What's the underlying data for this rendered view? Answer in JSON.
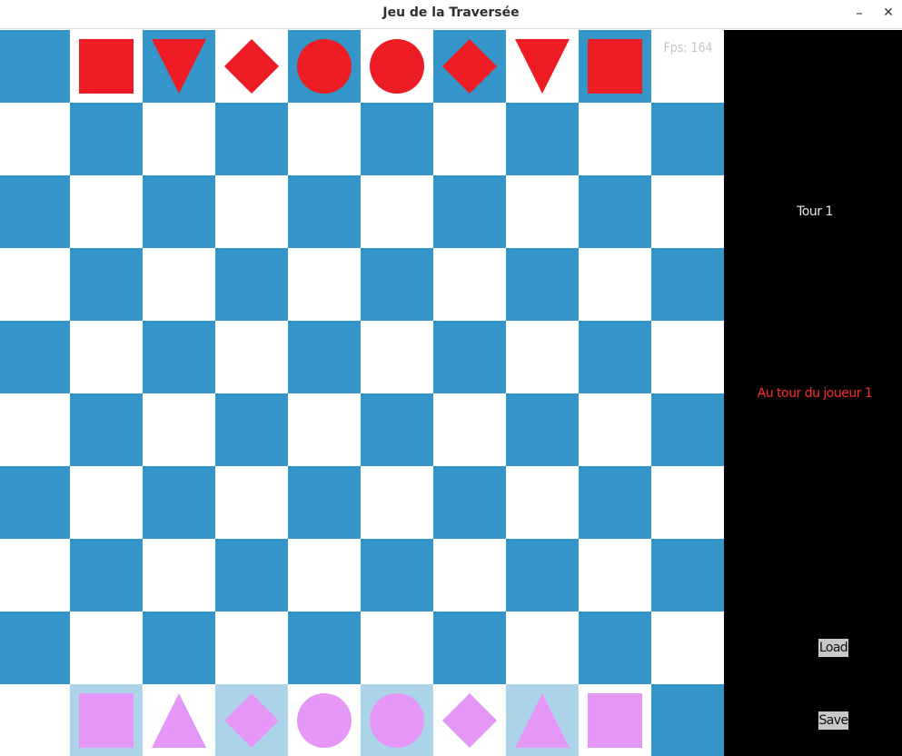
{
  "window": {
    "title": "Jeu de la Traversée",
    "minimize_symbol": "–",
    "close_symbol": "✕"
  },
  "hud": {
    "fps": "Fps: 164",
    "turn": "Tour 1",
    "current_player": "Au tour du joueur 1",
    "load_label": "Load",
    "save_label": "Save"
  },
  "colors": {
    "dark_square": "#3496c8",
    "light_square": "#ffffff",
    "highlight_square": "#acd4e8",
    "red_piece": "#ee1c25",
    "pink_piece": "#e597f7",
    "sidebar": "#000000"
  },
  "board": {
    "columns": 10,
    "rows": 10,
    "highlighted_cells": [
      {
        "col": 1,
        "row": 9
      },
      {
        "col": 3,
        "row": 9
      },
      {
        "col": 5,
        "row": 9
      },
      {
        "col": 7,
        "row": 9
      }
    ],
    "pieces": [
      {
        "player": 2,
        "shape": "square",
        "col": 1,
        "row": 0
      },
      {
        "player": 2,
        "shape": "triangle-down",
        "col": 2,
        "row": 0
      },
      {
        "player": 2,
        "shape": "diamond",
        "col": 3,
        "row": 0
      },
      {
        "player": 2,
        "shape": "circle",
        "col": 4,
        "row": 0
      },
      {
        "player": 2,
        "shape": "circle",
        "col": 5,
        "row": 0
      },
      {
        "player": 2,
        "shape": "diamond",
        "col": 6,
        "row": 0
      },
      {
        "player": 2,
        "shape": "triangle-down",
        "col": 7,
        "row": 0
      },
      {
        "player": 2,
        "shape": "square",
        "col": 8,
        "row": 0
      },
      {
        "player": 1,
        "shape": "square",
        "col": 1,
        "row": 9
      },
      {
        "player": 1,
        "shape": "triangle-up",
        "col": 2,
        "row": 9
      },
      {
        "player": 1,
        "shape": "diamond",
        "col": 3,
        "row": 9
      },
      {
        "player": 1,
        "shape": "circle",
        "col": 4,
        "row": 9
      },
      {
        "player": 1,
        "shape": "circle",
        "col": 5,
        "row": 9
      },
      {
        "player": 1,
        "shape": "diamond",
        "col": 6,
        "row": 9
      },
      {
        "player": 1,
        "shape": "triangle-up",
        "col": 7,
        "row": 9
      },
      {
        "player": 1,
        "shape": "square",
        "col": 8,
        "row": 9
      }
    ]
  }
}
